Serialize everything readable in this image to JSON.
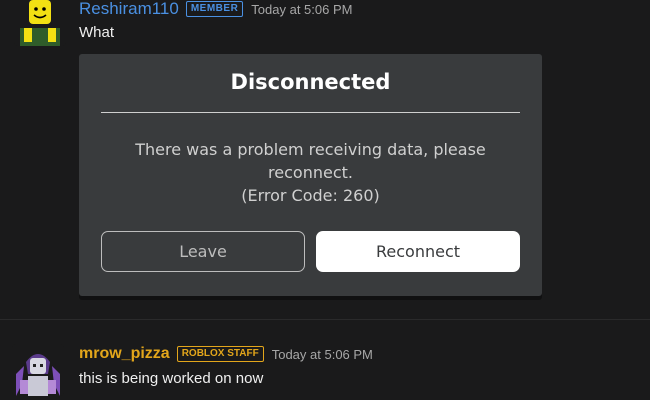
{
  "messages": [
    {
      "username": "Reshiram110",
      "badge": "MEMBER",
      "timestamp": "Today at 5:06 PM",
      "text": "What"
    },
    {
      "username": "mrow_pizza",
      "badge": "ROBLOX STAFF",
      "timestamp": "Today at 5:06 PM",
      "text": "this is being worked on now"
    }
  ],
  "dialog": {
    "title": "Disconnected",
    "message_line1": "There was a problem receiving data, please",
    "message_line2": "reconnect.",
    "error_code": "(Error Code: 260)",
    "leave_label": "Leave",
    "reconnect_label": "Reconnect"
  },
  "colors": {
    "background": "#1a1a1b",
    "member_blue": "#4a90e2",
    "staff_gold": "#e3a61b",
    "dialog_bg": "#393b3d"
  },
  "icons": {
    "avatar1": "yellow-noob-avatar",
    "avatar2": "purple-character-avatar"
  }
}
